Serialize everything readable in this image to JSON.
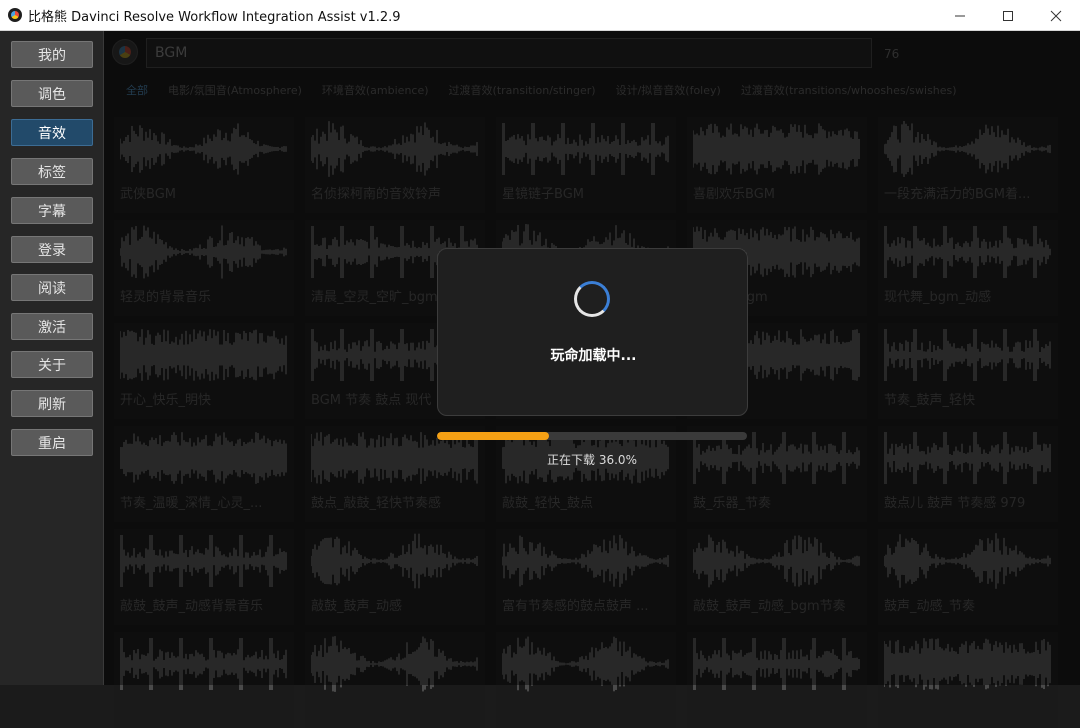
{
  "window": {
    "title": "比格熊 Davinci Resolve Workflow Integration Assist v1.2.9",
    "minimize_icon": "minimize-icon",
    "maximize_icon": "maximize-icon",
    "close_icon": "close-icon"
  },
  "sidebar": {
    "items": [
      {
        "label": "我的"
      },
      {
        "label": "调色"
      },
      {
        "label": "音效",
        "active": true
      },
      {
        "label": "标签"
      },
      {
        "label": "字幕"
      },
      {
        "label": "登录"
      },
      {
        "label": "阅读"
      },
      {
        "label": "激活"
      },
      {
        "label": "关于"
      },
      {
        "label": "刷新"
      },
      {
        "label": "重启"
      }
    ]
  },
  "search": {
    "value": "BGM",
    "count": "76"
  },
  "tabs": [
    {
      "label": "全部",
      "active": true
    },
    {
      "label": "电影/氛围音(Atmosphere)"
    },
    {
      "label": "环境音效(ambience)"
    },
    {
      "label": "过渡音效(transition/stinger)"
    },
    {
      "label": "设计/拟音音效(foley)"
    },
    {
      "label": "过渡音效(transitions/whooshes/swishes)"
    }
  ],
  "clips": [
    "武侠BGM",
    "名侦探柯南的音效铃声",
    "星镜链子BGM",
    "喜剧欢乐BGM",
    "一段充满活力的BGM着...",
    "轻灵的背景音乐",
    "清晨_空灵_空旷_bgm",
    "",
    "美旋律_bgm",
    "现代舞_bgm_动感",
    "开心_快乐_明快",
    "BGM 节奏 鼓点 现代",
    "",
    "奏_节奏",
    "节奏_鼓声_轻快",
    "节奏_温暖_深情_心灵_...",
    "鼓点_敲鼓_轻快节奏感",
    "敲鼓_轻快_鼓点",
    "鼓_乐器_节奏",
    "鼓点儿 鼓声 节奏感 979",
    "敲鼓_鼓声_动感背景音乐",
    "敲鼓_鼓声_动感",
    "富有节奏感的鼓点鼓声 ...",
    "敲鼓_鼓声_动感_bgm节奏",
    "鼓声_动感_节奏",
    "",
    "",
    "",
    "",
    ""
  ],
  "loading": {
    "message": "玩命加载中...",
    "progress_text": "正在下载 36.0%",
    "progress": 0.36,
    "spinner_icon": "spinner-icon"
  },
  "colors": {
    "accent": "#224a6a",
    "progress": "#f5a014",
    "spinner": "#3b7fd6"
  }
}
